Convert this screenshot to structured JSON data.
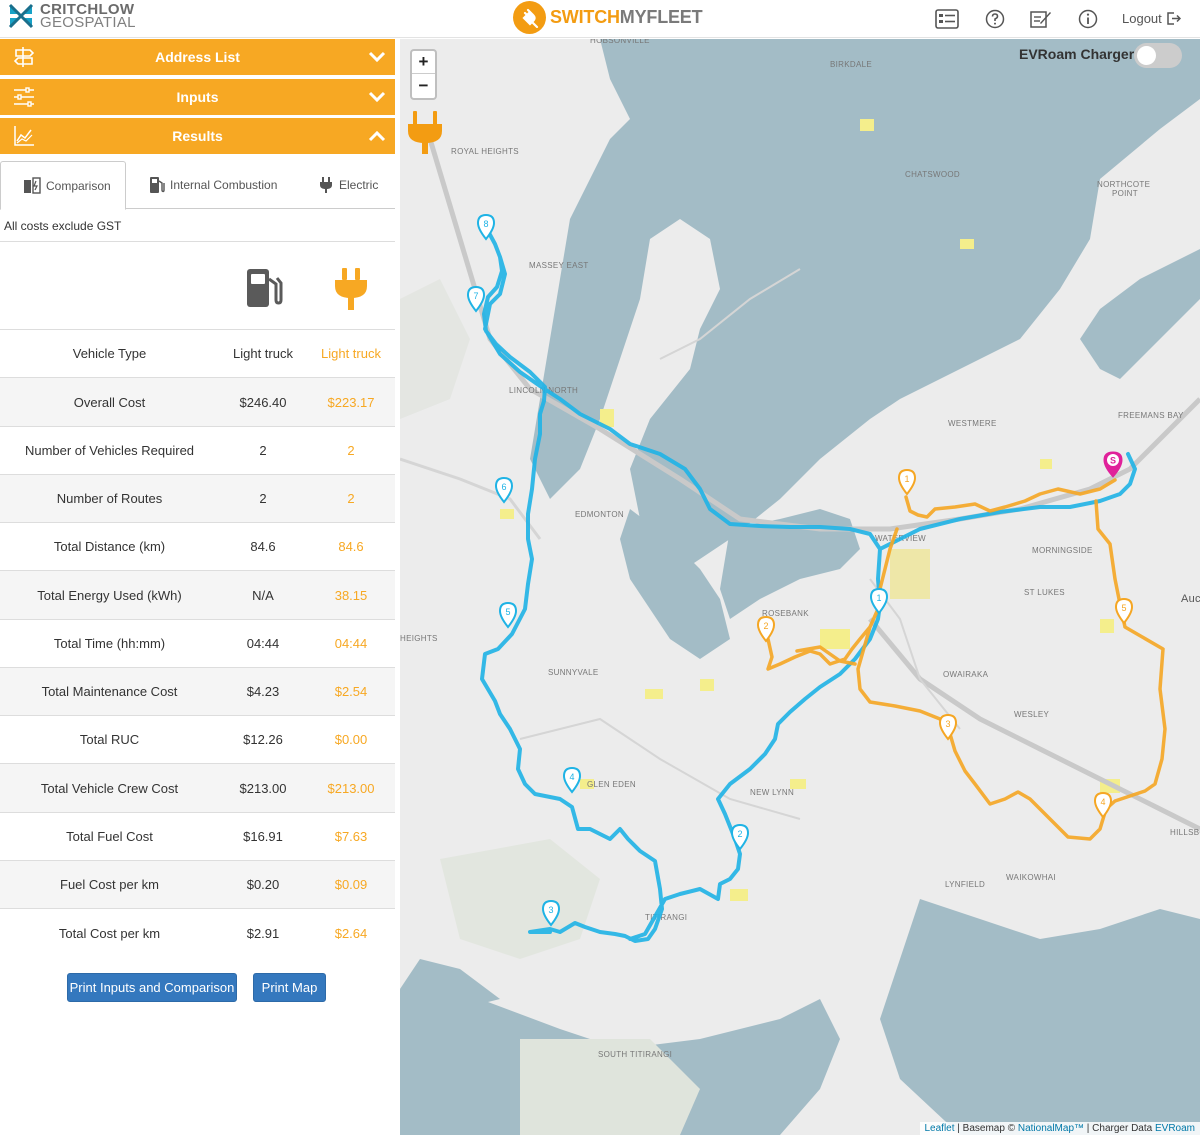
{
  "header": {
    "left_logo_line1": "CRITCHLOW",
    "left_logo_line2": "GEOSPATIAL",
    "brand_part1": "SWITCH",
    "brand_part2": "MYFLEET",
    "logout": "Logout",
    "icons": [
      "report-icon",
      "help-icon",
      "edit-icon",
      "info-icon",
      "logout-icon"
    ]
  },
  "accordion": {
    "address_list": "Address List",
    "inputs": "Inputs",
    "results": "Results"
  },
  "tabs": {
    "comparison": "Comparison",
    "internal_combustion": "Internal Combustion",
    "electric": "Electric"
  },
  "note": "All costs exclude GST",
  "table": {
    "rows": [
      {
        "label": "Vehicle Type",
        "ice": "Light truck",
        "ev": "Light truck"
      },
      {
        "label": "Overall Cost",
        "ice": "$246.40",
        "ev": "$223.17"
      },
      {
        "label": "Number of Vehicles Required",
        "ice": "2",
        "ev": "2"
      },
      {
        "label": "Number of Routes",
        "ice": "2",
        "ev": "2"
      },
      {
        "label": "Total Distance (km)",
        "ice": "84.6",
        "ev": "84.6"
      },
      {
        "label": "Total Energy Used (kWh)",
        "ice": "N/A",
        "ev": "38.15"
      },
      {
        "label": "Total Time (hh:mm)",
        "ice": "04:44",
        "ev": "04:44"
      },
      {
        "label": "Total Maintenance Cost",
        "ice": "$4.23",
        "ev": "$2.54"
      },
      {
        "label": "Total RUC",
        "ice": "$12.26",
        "ev": "$0.00"
      },
      {
        "label": "Total Vehicle Crew Cost",
        "ice": "$213.00",
        "ev": "$213.00"
      },
      {
        "label": "Total Fuel Cost",
        "ice": "$16.91",
        "ev": "$7.63"
      },
      {
        "label": "Fuel Cost per km",
        "ice": "$0.20",
        "ev": "$0.09"
      },
      {
        "label": "Total Cost per km",
        "ice": "$2.91",
        "ev": "$2.64"
      }
    ]
  },
  "buttons": {
    "print_inputs": "Print Inputs and Comparison",
    "print_map": "Print Map"
  },
  "map": {
    "zoom_in": "+",
    "zoom_out": "−",
    "evroam_label": "EVRoam Chargers",
    "evroam_enabled": false,
    "attribution_leaflet": "Leaflet",
    "attribution_basemap": " | Basemap © ",
    "attribution_nationalmap": "NationalMap™",
    "attribution_charger": " | Charger Data ",
    "attribution_evroam": "EVRoam",
    "places": [
      "HOBSONVILLE",
      "BIRKDALE",
      "ROYAL HEIGHTS",
      "CHATSWOOD",
      "NORTHCOTE POINT",
      "MASSEY EAST",
      "LINCOLN NORTH",
      "WESTMERE",
      "FREEMANS BAY",
      "EDMONTON",
      "WATERVIEW",
      "MORNINGSIDE",
      "ROSEBANK",
      "ST LUKES",
      "HEIGHTS",
      "SUNNYVALE",
      "OWAIRAKA",
      "Auc",
      "WESLEY",
      "GLEN EDEN",
      "NEW LYNN",
      "HILLSBO",
      "WAIKOWHAI",
      "LYNFIELD",
      "TITIRANGI",
      "SOUTH TITIRANGI"
    ],
    "blue_markers": [
      "1",
      "2",
      "3",
      "4",
      "5",
      "6",
      "7",
      "8"
    ],
    "orange_markers": [
      "1",
      "2",
      "3",
      "4",
      "5"
    ],
    "start_marker": "S"
  },
  "colors": {
    "accent": "#f7a823",
    "route_blue": "#1fb3e5",
    "route_orange": "#f5a623",
    "start_magenta": "#e0219a",
    "button_blue": "#3478be"
  }
}
